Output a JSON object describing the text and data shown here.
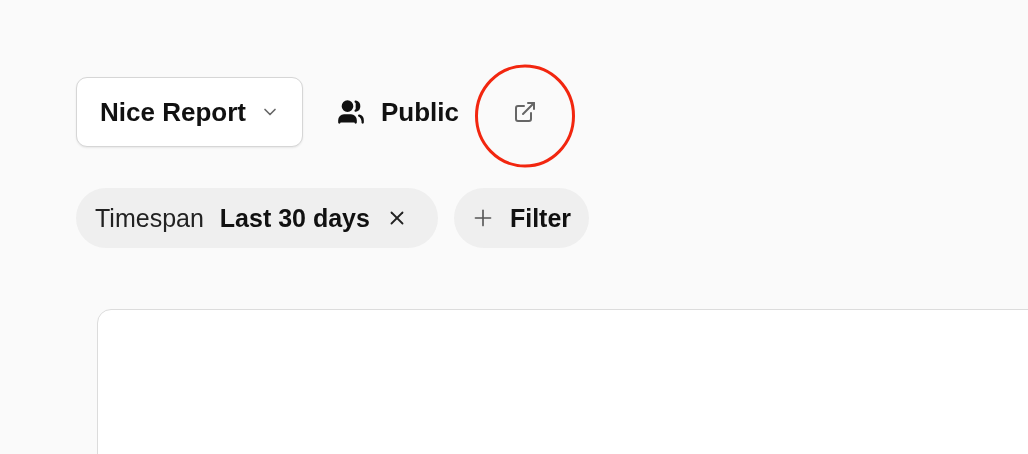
{
  "report_selector": {
    "label": "Nice Report"
  },
  "visibility": {
    "label": "Public"
  },
  "filters": [
    {
      "kind": "timespan",
      "label": "Timespan",
      "value": "Last 30 days"
    }
  ],
  "add_filter": {
    "label": "Filter"
  }
}
